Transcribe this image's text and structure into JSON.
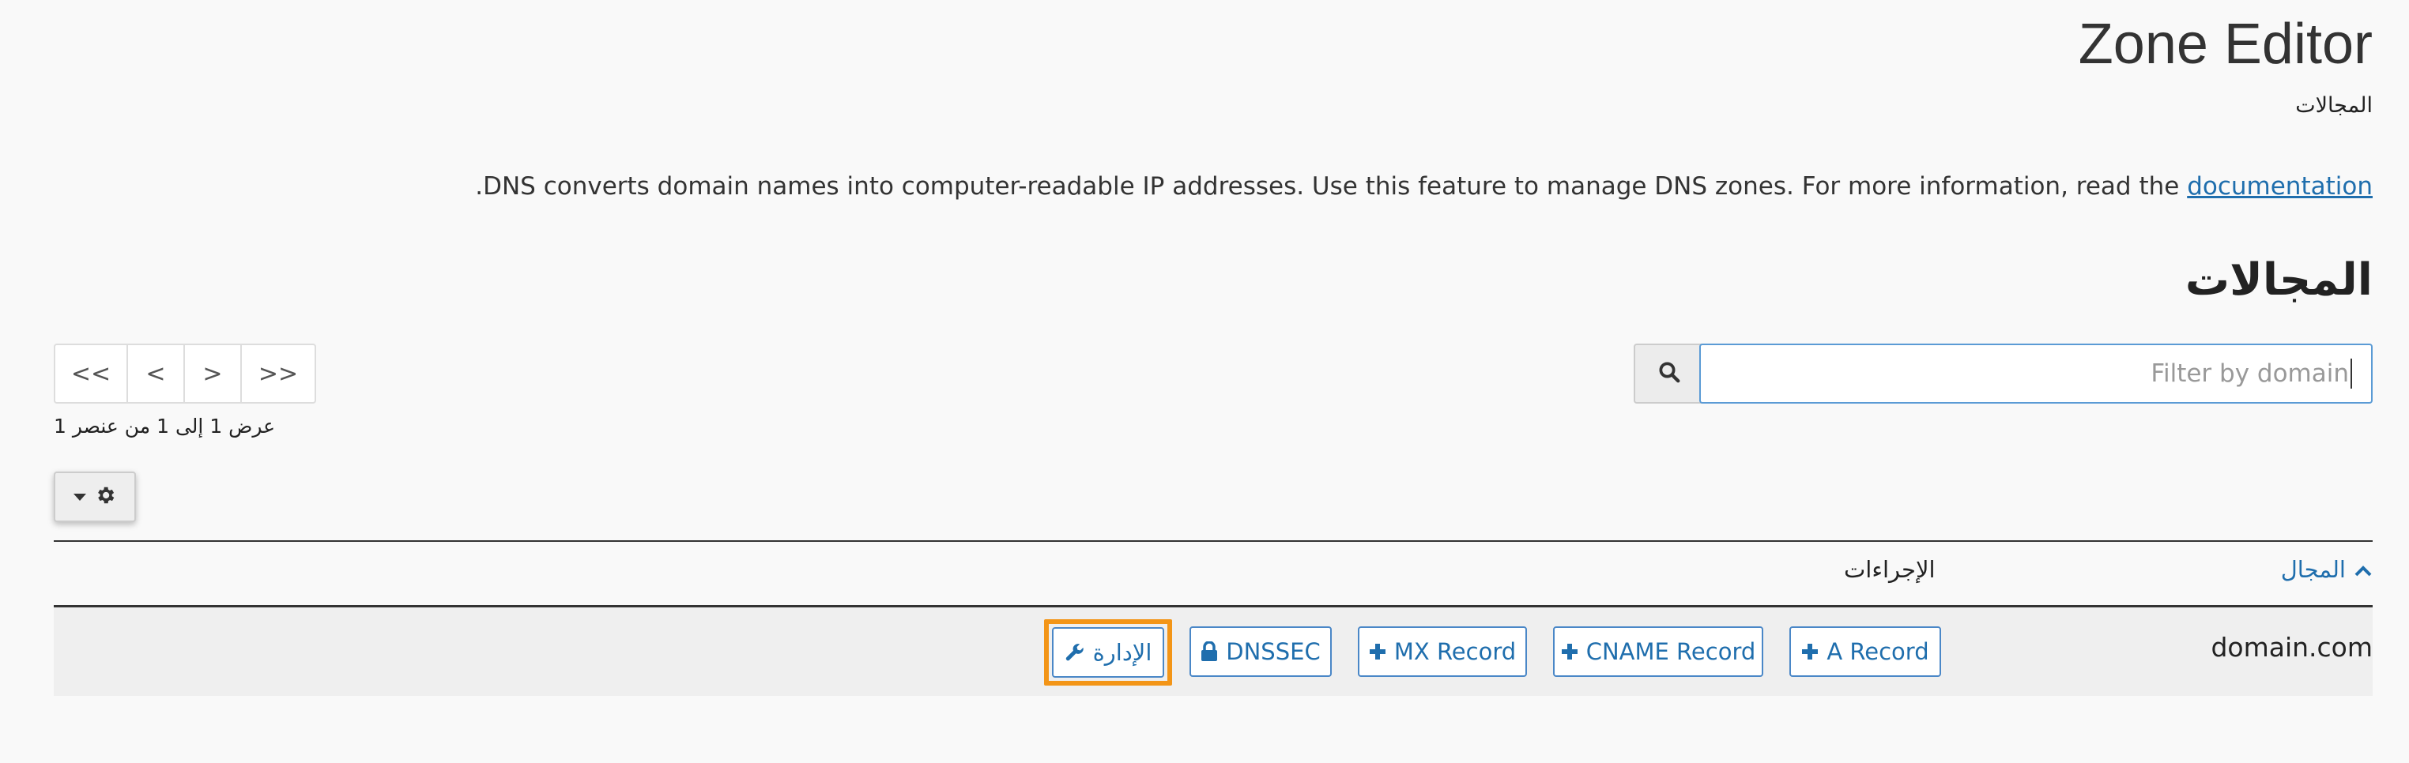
{
  "header": {
    "title": "Zone Editor",
    "subtitle": "المجالات"
  },
  "description": {
    "text": "DNS converts domain names into computer-readable IP addresses. Use this feature to manage DNS zones. For more information, read the",
    "link_label": "documentation",
    "end": "."
  },
  "section": {
    "title": "المجالات"
  },
  "search": {
    "placeholder": "Filter by domain",
    "icon": "search-icon"
  },
  "pagination": {
    "first": "<<",
    "prev": "<",
    "next": ">",
    "last": ">>",
    "info": "عرض 1 إلى 1 من عنصر 1"
  },
  "settings": {
    "icon": "gear-icon",
    "caret": "caret-down-icon"
  },
  "table": {
    "columns": {
      "domain": "المجال",
      "actions": "الإجراءات"
    },
    "rows": [
      {
        "domain": "domain.com",
        "actions": {
          "a_record": "A Record",
          "cname_record": "CNAME Record",
          "mx_record": "MX Record",
          "dnssec": "DNSSEC",
          "manage": "الإدارة"
        }
      }
    ]
  },
  "colors": {
    "accent": "#1f6ead",
    "highlight": "#f39517",
    "background": "#f9f9f9"
  }
}
